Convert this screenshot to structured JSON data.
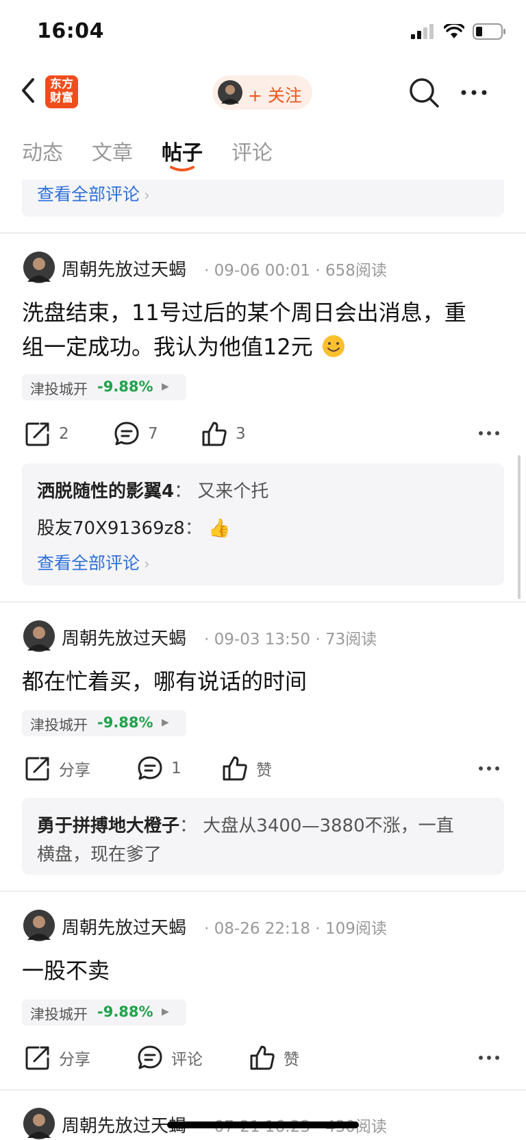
{
  "status": {
    "time": "16:04",
    "icons": [
      "signal-icon",
      "wifi-icon",
      "battery-icon"
    ]
  },
  "nav": {
    "logo_line1": "东方",
    "logo_line2": "财富",
    "follow": "+ 关注"
  },
  "tabs": [
    {
      "label": "动态"
    },
    {
      "label": "文章"
    },
    {
      "label": "帖子"
    },
    {
      "label": "评论"
    }
  ],
  "top_card": {
    "view_all": "查看全部评论"
  },
  "posts": [
    {
      "author": "周朝先放过天蝎",
      "meta": "· 09-06 00:01 · 658阅读",
      "text_line1": "洗盘结束，11号过后的某个周日会出消息，重",
      "text_line2": "组一定成功。我认为他值12元",
      "stock": {
        "name": "津投城开",
        "pct": "-9.88%"
      },
      "share": "2",
      "comments": "7",
      "likes": "3",
      "replies": [
        {
          "name": "洒脱随性的影翼4",
          "sep": "：",
          "text": "又来个托"
        },
        {
          "name": "股友70X91369z8",
          "sep": "：",
          "text": "👍"
        }
      ],
      "view_all": "查看全部评论"
    },
    {
      "author": "周朝先放过天蝎",
      "meta": "· 09-03 13:50 · 73阅读",
      "text_line1": "都在忙着买，哪有说话的时间",
      "stock": {
        "name": "津投城开",
        "pct": "-9.88%"
      },
      "share": "分享",
      "comments": "1",
      "likes": "赞",
      "replies": [
        {
          "name": "勇于拼搏地大橙子",
          "sep": "：",
          "text": "大盘从3400—3880不涨，一直",
          "text2": "横盘，现在爹了"
        }
      ]
    },
    {
      "author": "周朝先放过天蝎",
      "meta": "· 08-26 22:18 · 109阅读",
      "text_line1": "一股不卖",
      "stock": {
        "name": "津投城开",
        "pct": "-9.88%"
      },
      "share": "分享",
      "comments": "评论",
      "likes": "赞"
    },
    {
      "author": "周朝先放过天蝎",
      "meta": "· 07-21 16:23 · 430阅读"
    }
  ],
  "colors": {
    "accent": "#f0561d",
    "link": "#2f6fd9",
    "down": "#1fa24b"
  }
}
